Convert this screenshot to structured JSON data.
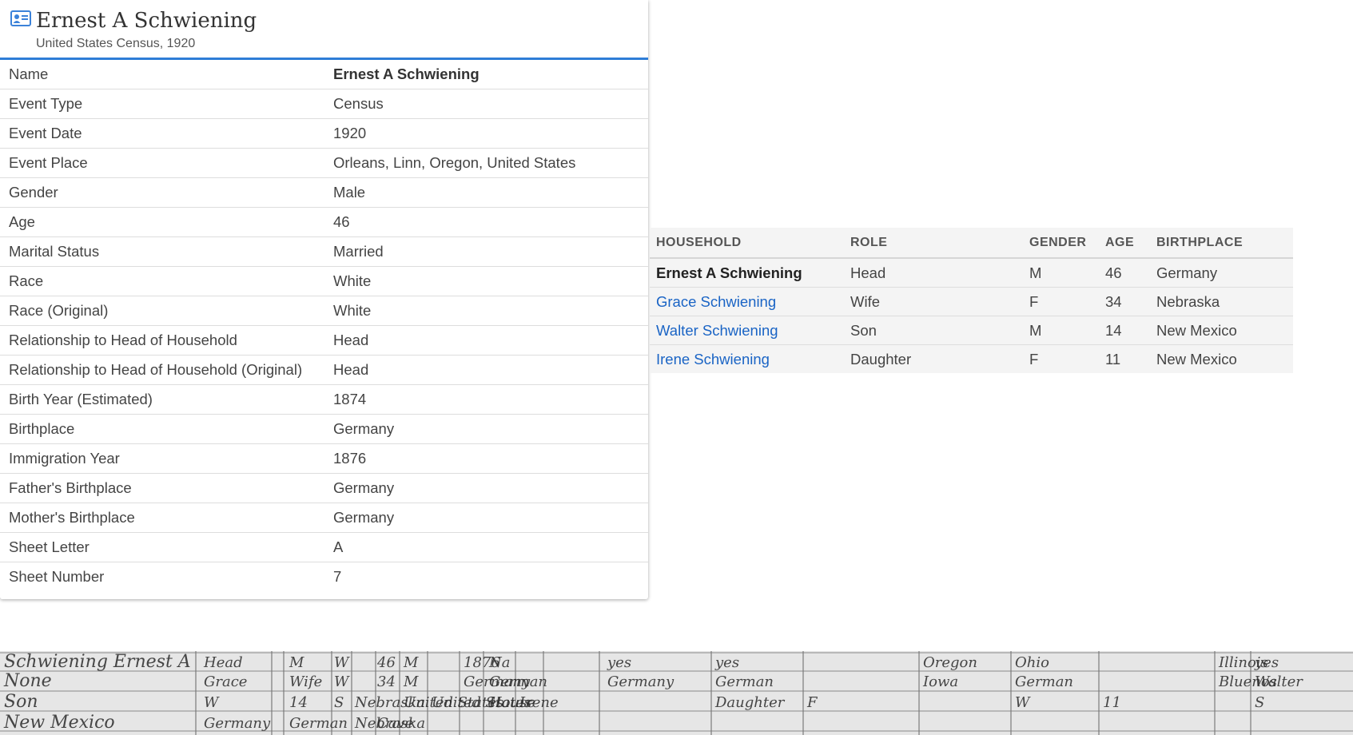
{
  "record": {
    "name": "Ernest A Schwiening",
    "collection": "United States Census, 1920",
    "icon": "person-card-icon",
    "accent_color": "#2e7dd7"
  },
  "facts": [
    {
      "label": "Name",
      "value": "Ernest A Schwiening"
    },
    {
      "label": "Event Type",
      "value": "Census"
    },
    {
      "label": "Event Date",
      "value": "1920"
    },
    {
      "label": "Event Place",
      "value": "Orleans, Linn, Oregon, United States"
    },
    {
      "label": "Gender",
      "value": "Male"
    },
    {
      "label": "Age",
      "value": "46"
    },
    {
      "label": "Marital Status",
      "value": "Married"
    },
    {
      "label": "Race",
      "value": "White"
    },
    {
      "label": "Race (Original)",
      "value": "White"
    },
    {
      "label": "Relationship to Head of Household",
      "value": "Head"
    },
    {
      "label": "Relationship to Head of Household (Original)",
      "value": "Head"
    },
    {
      "label": "Birth Year (Estimated)",
      "value": "1874"
    },
    {
      "label": "Birthplace",
      "value": "Germany"
    },
    {
      "label": "Immigration Year",
      "value": "1876"
    },
    {
      "label": "Father's Birthplace",
      "value": "Germany"
    },
    {
      "label": "Mother's Birthplace",
      "value": "Germany"
    },
    {
      "label": "Sheet Letter",
      "value": "A"
    },
    {
      "label": "Sheet Number",
      "value": "7"
    }
  ],
  "household": {
    "headers": [
      "HOUSEHOLD",
      "ROLE",
      "GENDER",
      "AGE",
      "BIRTHPLACE"
    ],
    "link_color": "#1a64c5",
    "members": [
      {
        "name": "Ernest A Schwiening",
        "role": "Head",
        "gender": "M",
        "age": "46",
        "birthplace": "Germany"
      },
      {
        "name": "Grace Schwiening",
        "role": "Wife",
        "gender": "F",
        "age": "34",
        "birthplace": "Nebraska"
      },
      {
        "name": "Walter Schwiening",
        "role": "Son",
        "gender": "M",
        "age": "14",
        "birthplace": "New Mexico"
      },
      {
        "name": "Irene Schwiening",
        "role": "Daughter",
        "gender": "F",
        "age": "11",
        "birthplace": "New Mexico"
      }
    ]
  },
  "census_image": {
    "handwriting": [
      "Schwiening Ernest A",
      "Head",
      "M",
      "W",
      "46",
      "M",
      "1876",
      "Na",
      "yes",
      "yes",
      "Oregon",
      "Ohio",
      "Illinois",
      "yes",
      "None",
      "Grace",
      "Wife",
      "W",
      "34",
      "M",
      "Germany",
      "German",
      "Germany",
      "German",
      "Iowa",
      "German",
      "Bluenos",
      "Walter",
      "Son",
      "W",
      "14",
      "S",
      "Nebraska",
      "United States",
      "United States",
      "House",
      "Irene",
      "Daughter",
      "F",
      "W",
      "11",
      "S",
      "New Mexico",
      "Germany",
      "German",
      "Nebraska",
      "Cave"
    ]
  }
}
